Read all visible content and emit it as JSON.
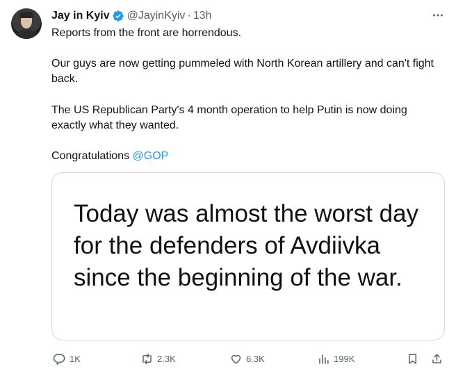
{
  "author": {
    "name": "Jay in Kyiv",
    "handle": "@JayinKyiv",
    "separator": "·",
    "time": "13h"
  },
  "tweet": {
    "p1": "Reports from the front are horrendous.",
    "p2": "Our guys are now getting pummeled with North Korean artillery and can't fight back.",
    "p3": "The US Republican Party's 4 month operation to help Putin is now doing exactly what they wanted.",
    "p4_prefix": "Congratulations ",
    "p4_mention": "@GOP"
  },
  "card": {
    "text": "Today was almost the worst day for the defenders of Avdiivka since the beginning of the war."
  },
  "actions": {
    "replies": "1K",
    "reposts": "2.3K",
    "likes": "6.3K",
    "views": "199K"
  },
  "colors": {
    "accent": "#1d9bf0",
    "secondary_text": "#536471",
    "primary_text": "#0f1419"
  },
  "icons": [
    "verified-badge-icon",
    "more-icon",
    "reply-icon",
    "repost-icon",
    "like-icon",
    "views-icon",
    "bookmark-icon",
    "share-icon"
  ]
}
